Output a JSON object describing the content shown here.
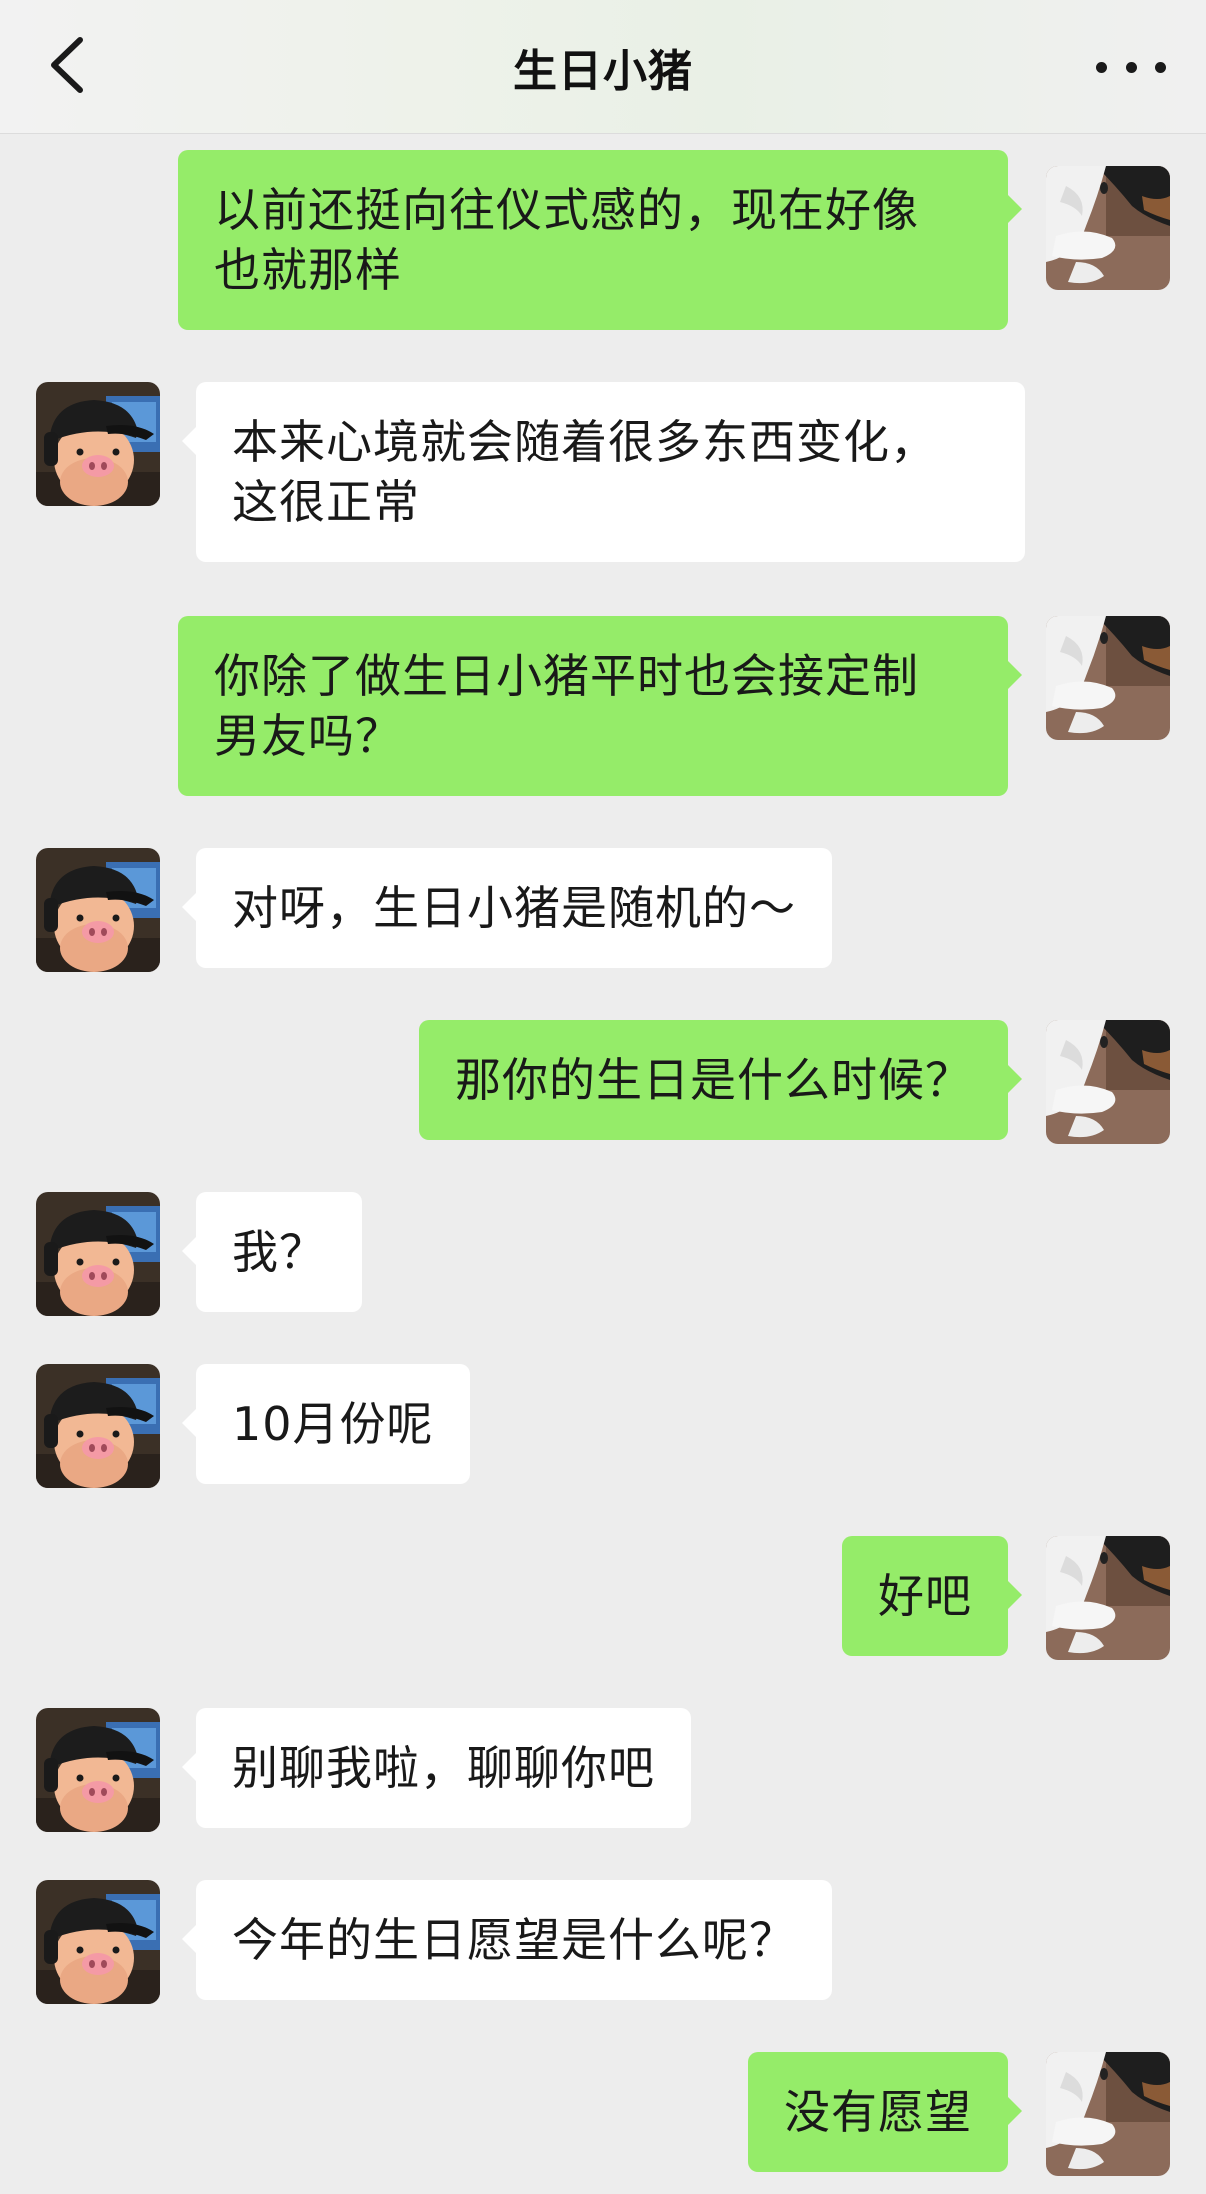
{
  "header": {
    "title": "生日小猪",
    "back_icon": "chevron-left-icon",
    "more_icon": "more-dots-icon"
  },
  "colors": {
    "sent_bubble": "#95ec69",
    "received_bubble": "#ffffff",
    "background": "#ededed"
  },
  "messages": [
    {
      "side": "right",
      "sender": "me",
      "text": "以前还挺向往仪式感的，现在好像\n也就那样"
    },
    {
      "side": "left",
      "sender": "contact",
      "text": "本来心境就会随着很多东西变化，\n这很正常"
    },
    {
      "side": "right",
      "sender": "me",
      "text": "你除了做生日小猪平时也会接定制\n男友吗？"
    },
    {
      "side": "left",
      "sender": "contact",
      "text": "对呀，生日小猪是随机的～"
    },
    {
      "side": "right",
      "sender": "me",
      "text": "那你的生日是什么时候？"
    },
    {
      "side": "left",
      "sender": "contact",
      "text": "我？"
    },
    {
      "side": "left",
      "sender": "contact",
      "text": "10月份呢"
    },
    {
      "side": "right",
      "sender": "me",
      "text": "好吧"
    },
    {
      "side": "left",
      "sender": "contact",
      "text": "别聊我啦，聊聊你吧"
    },
    {
      "side": "left",
      "sender": "contact",
      "text": "今年的生日愿望是什么呢？"
    },
    {
      "side": "right",
      "sender": "me",
      "text": "没有愿望"
    }
  ]
}
